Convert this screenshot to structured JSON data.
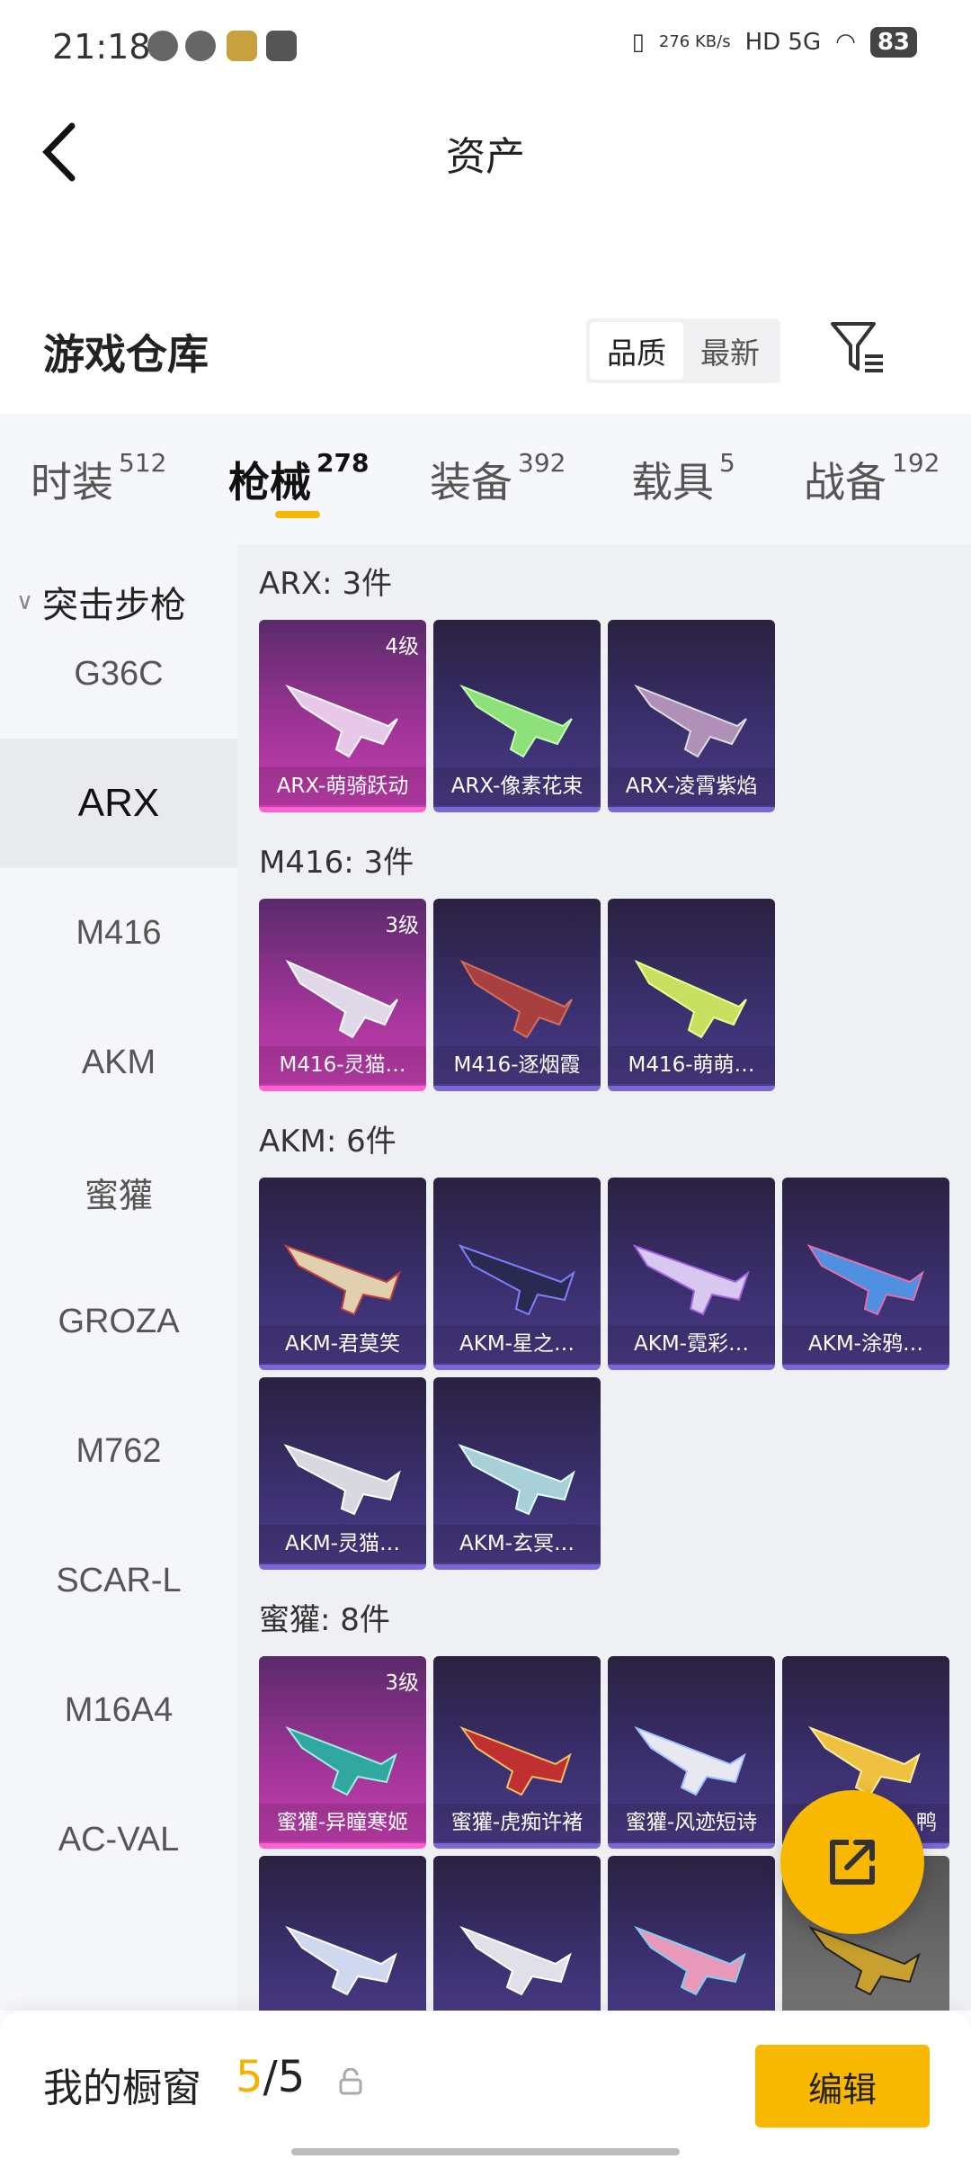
{
  "status": {
    "time": "21:18",
    "speed": "276\nKB/s",
    "net": "HD 5G",
    "battery": "83"
  },
  "header": {
    "title": "资产"
  },
  "warehouse": {
    "title": "游戏仓库",
    "sort_quality": "品质",
    "sort_latest": "最新"
  },
  "tabs": [
    {
      "label": "时装",
      "count": "512"
    },
    {
      "label": "枪械",
      "count": "278"
    },
    {
      "label": "装备",
      "count": "392"
    },
    {
      "label": "载具",
      "count": "5"
    },
    {
      "label": "战备",
      "count": "192"
    }
  ],
  "sidebar": {
    "category": "突击步枪",
    "items": [
      "G36C",
      "ARX",
      "M416",
      "AKM",
      "蜜獾",
      "GROZA",
      "M762",
      "SCAR-L",
      "M16A4",
      "AC-VAL"
    ]
  },
  "sections": [
    {
      "title": "ARX: 3件",
      "cards": [
        {
          "name": "ARX-萌骑跃动",
          "level": "4级"
        },
        {
          "name": "ARX-像素花束",
          "level": ""
        },
        {
          "name": "ARX-凌霄紫焰",
          "level": ""
        }
      ]
    },
    {
      "title": "M416: 3件",
      "cards": [
        {
          "name": "M416-灵猫…",
          "level": "3级"
        },
        {
          "name": "M416-逐烟霞",
          "level": ""
        },
        {
          "name": "M416-萌萌…",
          "level": ""
        }
      ]
    },
    {
      "title": "AKM: 6件",
      "cards": [
        {
          "name": "AKM-君莫笑",
          "level": ""
        },
        {
          "name": "AKM-星之…",
          "level": ""
        },
        {
          "name": "AKM-霓彩…",
          "level": ""
        },
        {
          "name": "AKM-涂鸦…",
          "level": ""
        },
        {
          "name": "AKM-灵猫…",
          "level": ""
        },
        {
          "name": "AKM-玄冥…",
          "level": ""
        }
      ]
    },
    {
      "title": "蜜獾: 8件",
      "cards": [
        {
          "name": "蜜獾-异瞳寒姬",
          "level": "3级"
        },
        {
          "name": "蜜獾-虎痴许褚",
          "level": ""
        },
        {
          "name": "蜜獾-风迹短诗",
          "level": ""
        },
        {
          "name": "鸭",
          "level": ""
        }
      ]
    }
  ],
  "bottom": {
    "label": "我的橱窗",
    "current": "5",
    "total": "/5",
    "edit": "编辑"
  },
  "colors": {
    "accent": "#f9b800",
    "card_purple": "#3b3070",
    "card_pink": "#c43fb0"
  }
}
